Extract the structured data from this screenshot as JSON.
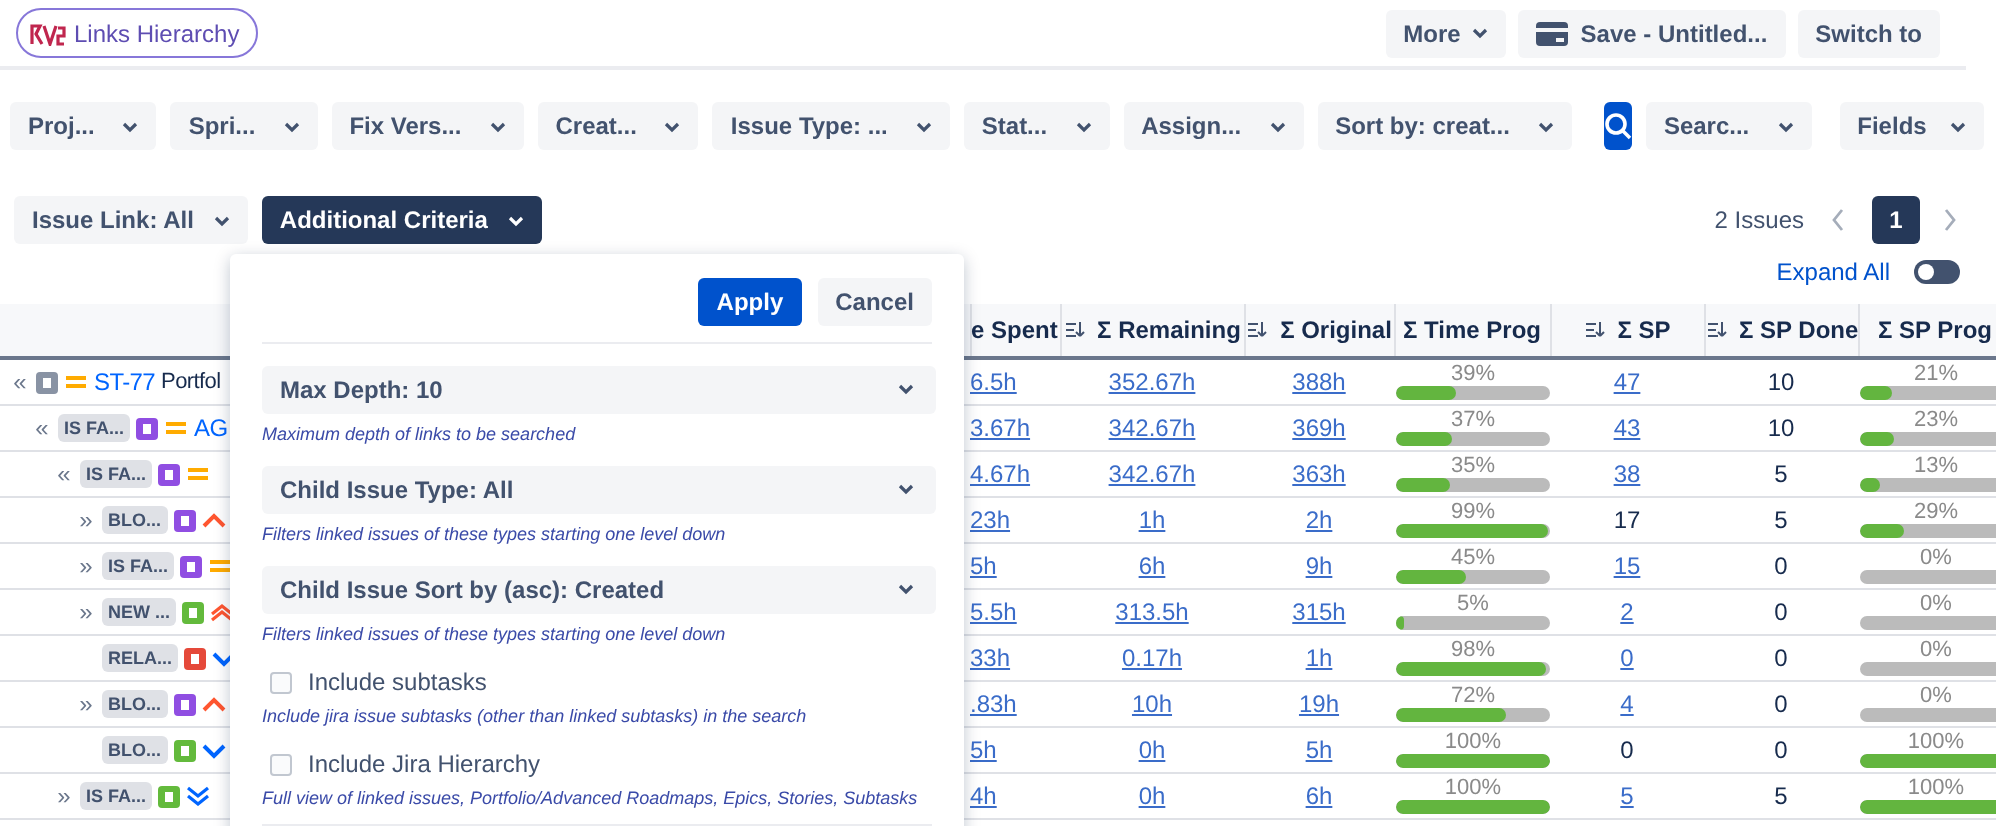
{
  "app_badge": {
    "title": "Links Hierarchy"
  },
  "header_buttons": [
    {
      "label": "More",
      "kind": "menu"
    },
    {
      "label": "Save - Untitled...",
      "kind": "save"
    },
    {
      "label": "Switch to",
      "kind": "plain"
    }
  ],
  "filters": [
    {
      "label": "Proj..."
    },
    {
      "label": "Spri..."
    },
    {
      "label": "Fix Vers..."
    },
    {
      "label": "Creat..."
    },
    {
      "label": "Issue Type: ..."
    },
    {
      "label": "Stat..."
    },
    {
      "label": "Assign..."
    },
    {
      "label": "Sort by: creat..."
    }
  ],
  "search_dropdown": {
    "label": "Searc..."
  },
  "fields_button": {
    "label": "Fields"
  },
  "criteria": [
    {
      "label": "Issue Link: All",
      "selected": false
    },
    {
      "label": "Additional Criteria",
      "selected": true
    }
  ],
  "pagination": {
    "count": "2 Issues",
    "pages": [
      {
        "label": "1",
        "selected": true
      }
    ]
  },
  "expand_all": {
    "label": "Expand All",
    "on": false
  },
  "table": {
    "columns": [
      {
        "label": "e Spent",
        "sortable": false
      },
      {
        "label": "Σ Remaining",
        "sortable": true
      },
      {
        "label": "Σ Original",
        "sortable": true
      },
      {
        "label": "Σ Time Prog",
        "sortable": false
      },
      {
        "label": "Σ SP",
        "sortable": true
      },
      {
        "label": "Σ SP Done",
        "sortable": true
      },
      {
        "label": "Σ SP Prog",
        "sortable": false
      }
    ],
    "rows": [
      {
        "toggle": "«",
        "color": "#8993a4",
        "priority": {
          "kind": "medium"
        },
        "key": "ST-77",
        "summary": "Portfol",
        "spent": "6.5h",
        "remaining": "352.67h",
        "original": "388h",
        "time_prog": {
          "reading": "39%",
          "level": 0.39
        },
        "sp": {
          "text": "47",
          "link": true
        },
        "sp_done": "10",
        "sp_prog": {
          "reading": "21%",
          "level": 0.21
        },
        "children": [
          {
            "toggle": "«",
            "link_type": "IS FA...",
            "color": "#904ee2",
            "priority": {
              "kind": "medium"
            },
            "key": "AG",
            "spent": "3.67h",
            "remaining": "342.67h",
            "original": "369h",
            "time_prog": {
              "reading": "37%",
              "level": 0.37
            },
            "sp": {
              "text": "43",
              "link": true
            },
            "sp_done": "10",
            "sp_prog": {
              "reading": "23%",
              "level": 0.23
            },
            "children": [
              {
                "toggle": "«",
                "link_type": "IS FA...",
                "color": "#904ee2",
                "priority": {
                  "kind": "medium"
                },
                "spent": "4.67h",
                "remaining": "342.67h",
                "original": "363h",
                "time_prog": {
                  "reading": "35%",
                  "level": 0.35
                },
                "sp": {
                  "text": "38",
                  "link": true
                },
                "sp_done": "5",
                "sp_prog": {
                  "reading": "13%",
                  "level": 0.13
                },
                "children": [
                  {
                    "toggle": "»",
                    "link_type": "BLO...",
                    "color": "#904ee2",
                    "priority": {
                      "kind": "high"
                    },
                    "spent": "23h",
                    "remaining": "1h",
                    "original": "2h",
                    "time_prog": {
                      "reading": "99%",
                      "level": 0.99
                    },
                    "sp": {
                      "text": "17",
                      "link": false
                    },
                    "sp_done": "5",
                    "sp_prog": {
                      "reading": "29%",
                      "level": 0.29
                    }
                  },
                  {
                    "toggle": "»",
                    "link_type": "IS FA...",
                    "color": "#904ee2",
                    "priority": {
                      "kind": "medium"
                    },
                    "spent": "5h",
                    "remaining": "6h",
                    "original": "9h",
                    "time_prog": {
                      "reading": "45%",
                      "level": 0.45
                    },
                    "sp": {
                      "text": "15",
                      "link": true
                    },
                    "sp_done": "0",
                    "sp_prog": {
                      "reading": "0%",
                      "level": 0
                    }
                  },
                  {
                    "toggle": "»",
                    "link_type": "NEW ...",
                    "color": "#63ba3c",
                    "priority": {
                      "kind": "highest"
                    },
                    "spent": "5.5h",
                    "remaining": "313.5h",
                    "original": "315h",
                    "time_prog": {
                      "reading": "5%",
                      "level": 0.05
                    },
                    "sp": {
                      "text": "2",
                      "link": true
                    },
                    "sp_done": "0",
                    "sp_prog": {
                      "reading": "0%",
                      "level": 0
                    }
                  },
                  {
                    "link_type": "RELA...",
                    "color": "#e5493a",
                    "priority": {
                      "kind": "low"
                    },
                    "spent": "33h",
                    "remaining": "0.17h",
                    "original": "1h",
                    "time_prog": {
                      "reading": "98%",
                      "level": 0.98
                    },
                    "sp": {
                      "text": "0",
                      "link": true
                    },
                    "sp_done": "0",
                    "sp_prog": {
                      "reading": "0%",
                      "level": 0
                    }
                  },
                  {
                    "toggle": "»",
                    "link_type": "BLO...",
                    "color": "#904ee2",
                    "priority": {
                      "kind": "high"
                    },
                    "spent": ".83h",
                    "remaining": "10h",
                    "original": "19h",
                    "time_prog": {
                      "reading": "72%",
                      "level": 0.72
                    },
                    "sp": {
                      "text": "4",
                      "link": true
                    },
                    "sp_done": "0",
                    "sp_prog": {
                      "reading": "0%",
                      "level": 0
                    }
                  },
                  {
                    "link_type": "BLO...",
                    "color": "#63ba3c",
                    "priority": {
                      "kind": "low"
                    },
                    "spent": "5h",
                    "remaining": "0h",
                    "original": "5h",
                    "time_prog": {
                      "reading": "100%",
                      "level": 1
                    },
                    "sp": {
                      "text": "0",
                      "link": false
                    },
                    "sp_done": "0",
                    "sp_prog": {
                      "reading": "100%",
                      "level": 1
                    }
                  }
                ]
              },
              {
                "toggle": "»",
                "link_type": "IS FA...",
                "color": "#63ba3c",
                "priority": {
                  "kind": "lowest"
                },
                "spent": "4h",
                "remaining": "0h",
                "original": "6h",
                "time_prog": {
                  "reading": "100%",
                  "level": 1
                },
                "sp": {
                  "text": "5",
                  "link": true
                },
                "sp_done": "5",
                "sp_prog": {
                  "reading": "100%",
                  "level": 1
                }
              }
            ]
          }
        ]
      }
    ]
  },
  "criteria_panel": {
    "buttons": [
      {
        "label": "Apply",
        "kind": "primary"
      },
      {
        "label": "Cancel",
        "kind": "secondary"
      }
    ],
    "options": [
      {
        "kind": "select",
        "label": "Max Depth: 10",
        "hint": "Maximum depth of links to be searched"
      },
      {
        "kind": "select",
        "label": "Child Issue Type: All",
        "hint": "Filters linked issues of these types starting one level down"
      },
      {
        "kind": "select",
        "label": "Child Issue Sort by (asc): Created",
        "hint": "Filters linked issues of these types starting one level down"
      },
      {
        "kind": "checkbox",
        "label": "Include subtasks",
        "checked": false,
        "hint": "Include jira issue subtasks (other than linked subtasks) in the search"
      },
      {
        "kind": "checkbox",
        "label": "Include Jira Hierarchy",
        "checked": false,
        "hint": "Full view of linked issues, Portfolio/Advanced Roadmaps, Epics, Stories, Subtasks"
      }
    ]
  }
}
